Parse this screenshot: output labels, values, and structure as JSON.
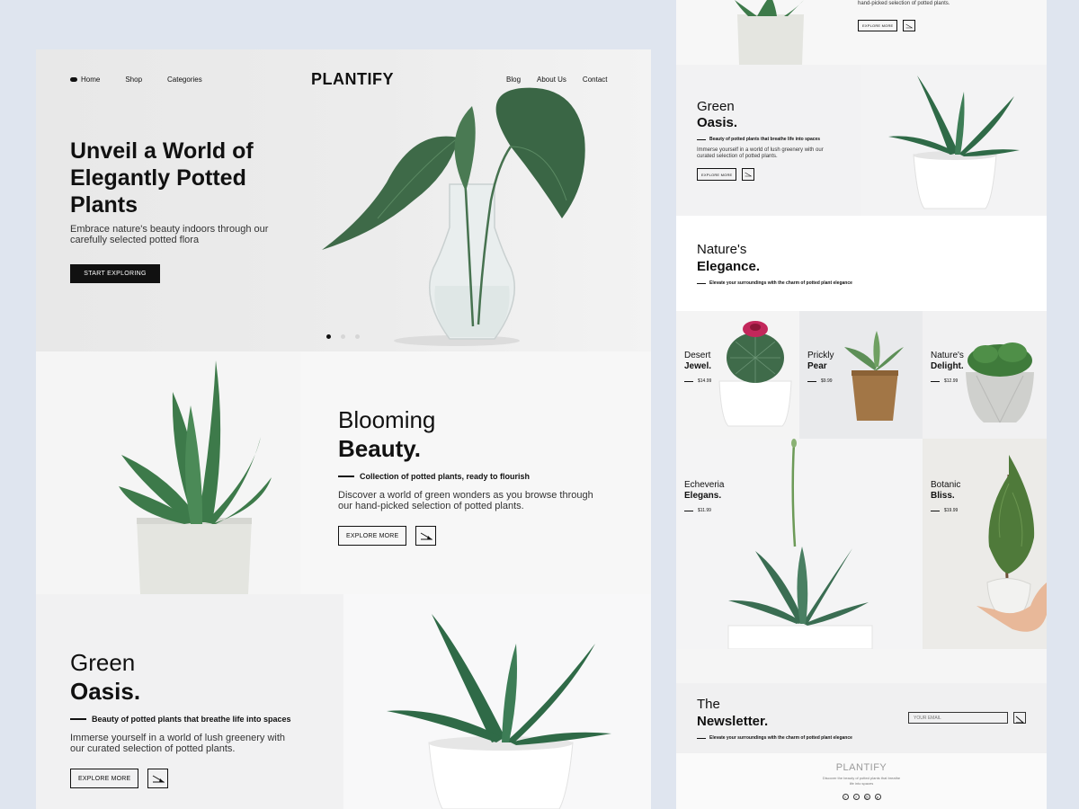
{
  "nav": {
    "left": [
      "Home",
      "Shop",
      "Categories"
    ],
    "right": [
      "Blog",
      "About Us",
      "Contact"
    ],
    "logo": "PLANTIFY"
  },
  "hero": {
    "title": "Unveil a World of Elegantly Potted Plants",
    "subtitle": "Embrace nature's beauty indoors through our carefully selected potted flora",
    "cta": "START EXPLORING",
    "slides": 3,
    "active_slide": 1
  },
  "blooming": {
    "title_light": "Blooming",
    "title_bold": "Beauty.",
    "tagline": "Collection of potted plants, ready to flourish",
    "description": "Discover a world of green wonders as you browse through our hand-picked selection of potted plants.",
    "cta": "EXPLORE MORE"
  },
  "oasis": {
    "title_light": "Green",
    "title_bold": "Oasis.",
    "tagline": "Beauty of potted plants that breathe life into spaces",
    "description": "Immerse yourself in a world of lush greenery with our curated selection of potted plants.",
    "cta": "EXPLORE MORE"
  },
  "right_top": {
    "description": "Discover a world of green wonders as you browse through our hand-picked selection of potted plants.",
    "cta": "EXPLORE MORE"
  },
  "nature": {
    "title_light": "Nature's",
    "title_bold": "Elegance.",
    "tagline": "Elevate your surroundings with the charm of potted plant elegance"
  },
  "products": [
    {
      "name_light": "Desert",
      "name_bold": "Jewel.",
      "price": "$14.99"
    },
    {
      "name_light": "Prickly",
      "name_bold": "Pear",
      "price": "$9.99"
    },
    {
      "name_light": "Nature's",
      "name_bold": "Delight.",
      "price": "$12.99"
    },
    {
      "name_light": "Echeveria",
      "name_bold": "Elegans.",
      "price": "$11.99"
    },
    {
      "name_light": "Botanic",
      "name_bold": "Bliss.",
      "price": "$19.99"
    }
  ],
  "newsletter": {
    "title_light": "The",
    "title_bold": "Newsletter.",
    "tagline": "Elevate your surroundings with the charm of potted plant elegance",
    "placeholder": "YOUR EMAIL"
  },
  "footer": {
    "logo": "PLANTIFY",
    "text": "Discover the beauty of potted plants that breathe life into spaces",
    "social": [
      "twitter-icon",
      "facebook-icon",
      "instagram-icon",
      "pinterest-icon"
    ]
  },
  "colors": {
    "accent": "#111111",
    "leaf": "#3f6f4c",
    "pot": "#ffffff",
    "background": "#dfe5ef"
  }
}
